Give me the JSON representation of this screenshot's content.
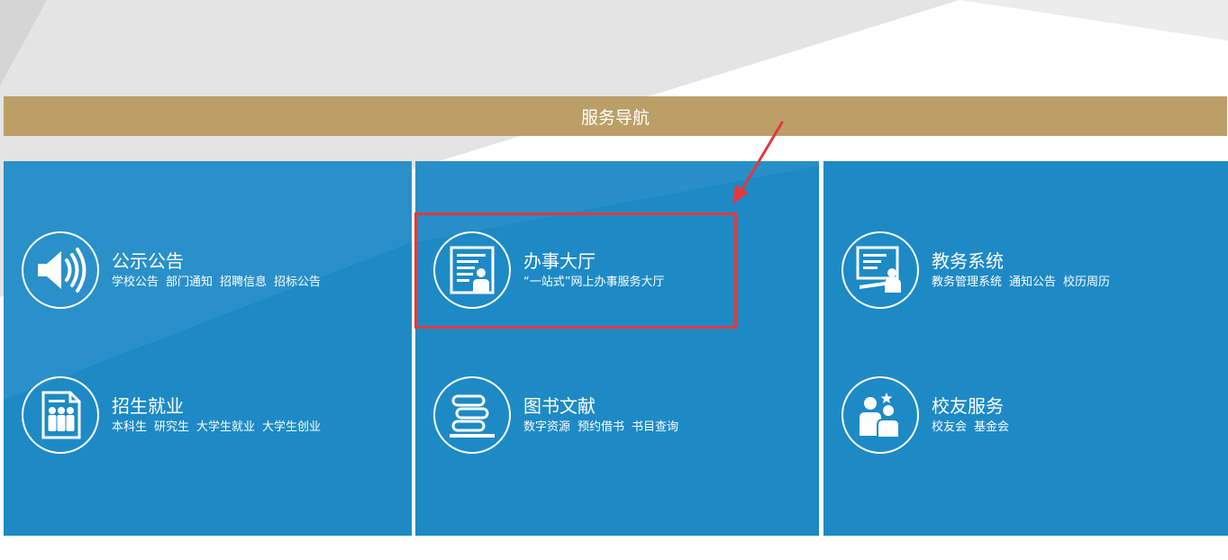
{
  "nav_title": "服务导航",
  "colors": {
    "accent_gold": "#bc9f66",
    "panel_blue": "#1d8ac6",
    "highlight_red": "#e2393d",
    "text": "#ffffff"
  },
  "panels": [
    {
      "items": [
        {
          "title": "公示公告",
          "icon": "speaker-icon",
          "links": [
            "学校公告",
            "部门通知",
            "招聘信息",
            "招标公告"
          ]
        },
        {
          "title": "招生就业",
          "icon": "people-board-icon",
          "links": [
            "本科生",
            "研究生",
            "大学生就业",
            "大学生创业"
          ]
        }
      ]
    },
    {
      "items": [
        {
          "title": "办事大厅",
          "icon": "service-hall-icon",
          "subtitle": "“一站式”网上办事服务大厅"
        },
        {
          "title": "图书文献",
          "icon": "books-icon",
          "links": [
            "数字资源",
            "预约借书",
            "书目查询"
          ]
        }
      ]
    },
    {
      "items": [
        {
          "title": "教务系统",
          "icon": "teacher-board-icon",
          "links": [
            "教务管理系统",
            "通知公告",
            "校历周历"
          ]
        },
        {
          "title": "校友服务",
          "icon": "alumni-icon",
          "links": [
            "校友会",
            "基金会"
          ]
        }
      ]
    }
  ]
}
